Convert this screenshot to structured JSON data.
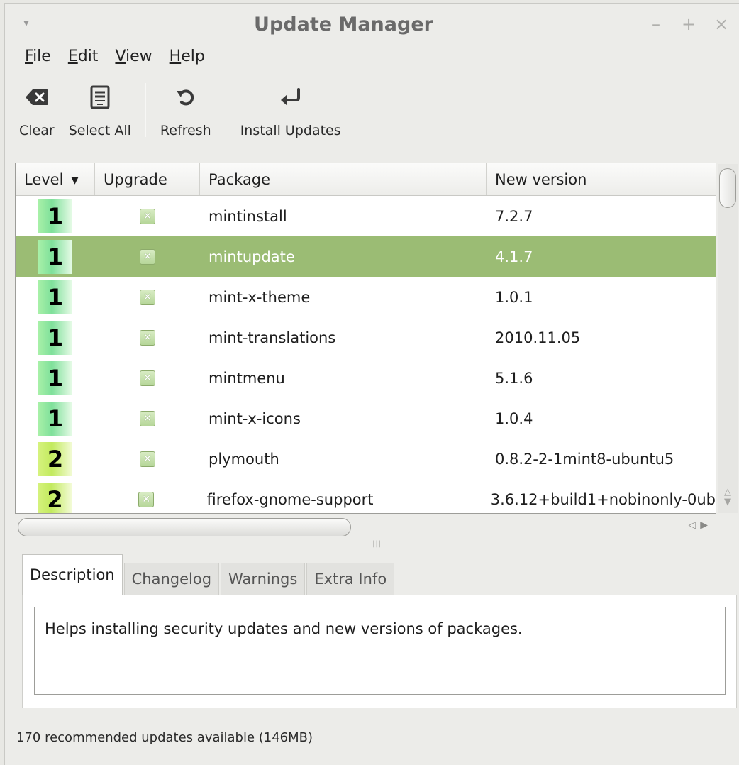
{
  "window": {
    "title": "Update Manager",
    "controls": {
      "menu": "▾",
      "minimize": "–",
      "maximize": "+",
      "close": "×"
    }
  },
  "menubar": [
    {
      "id": "file",
      "mnemonic": "F",
      "rest": "ile"
    },
    {
      "id": "edit",
      "mnemonic": "E",
      "rest": "dit"
    },
    {
      "id": "view",
      "mnemonic": "V",
      "rest": "iew"
    },
    {
      "id": "help",
      "mnemonic": "H",
      "rest": "elp"
    }
  ],
  "toolbar": {
    "clear": {
      "label": "Clear",
      "icon": "backspace-clear-icon"
    },
    "select_all": {
      "label": "Select All",
      "icon": "checklist-icon"
    },
    "refresh": {
      "label": "Refresh",
      "icon": "refresh-icon"
    },
    "install": {
      "label": "Install Updates",
      "icon": "enter-return-icon"
    }
  },
  "table": {
    "columns": {
      "level": "Level",
      "upgrade": "Upgrade",
      "package": "Package",
      "version": "New version"
    },
    "sort_indicator": "▼",
    "rows": [
      {
        "level": "1",
        "package": "mintinstall",
        "version": "7.2.7",
        "checked": true,
        "selected": false
      },
      {
        "level": "1",
        "package": "mintupdate",
        "version": "4.1.7",
        "checked": true,
        "selected": true
      },
      {
        "level": "1",
        "package": "mint-x-theme",
        "version": "1.0.1",
        "checked": true,
        "selected": false
      },
      {
        "level": "1",
        "package": "mint-translations",
        "version": "2010.11.05",
        "checked": true,
        "selected": false
      },
      {
        "level": "1",
        "package": "mintmenu",
        "version": "5.1.6",
        "checked": true,
        "selected": false
      },
      {
        "level": "1",
        "package": "mint-x-icons",
        "version": "1.0.4",
        "checked": true,
        "selected": false
      },
      {
        "level": "2",
        "package": "plymouth",
        "version": "0.8.2-2-1mint8-ubuntu5",
        "checked": true,
        "selected": false
      },
      {
        "level": "2",
        "package": "firefox-gnome-support",
        "version": "3.6.12+build1+nobinonly-0ub",
        "checked": true,
        "selected": false
      }
    ]
  },
  "tabs": {
    "description": "Description",
    "changelog": "Changelog",
    "warnings": "Warnings",
    "extra_info": "Extra Info"
  },
  "description_text": "Helps installing security updates and new versions of packages.",
  "status": "170 recommended updates available (146MB)",
  "colors": {
    "selected_row": "#9bbc74",
    "level1": "#7ee09a",
    "level2": "#c2ea5e"
  }
}
